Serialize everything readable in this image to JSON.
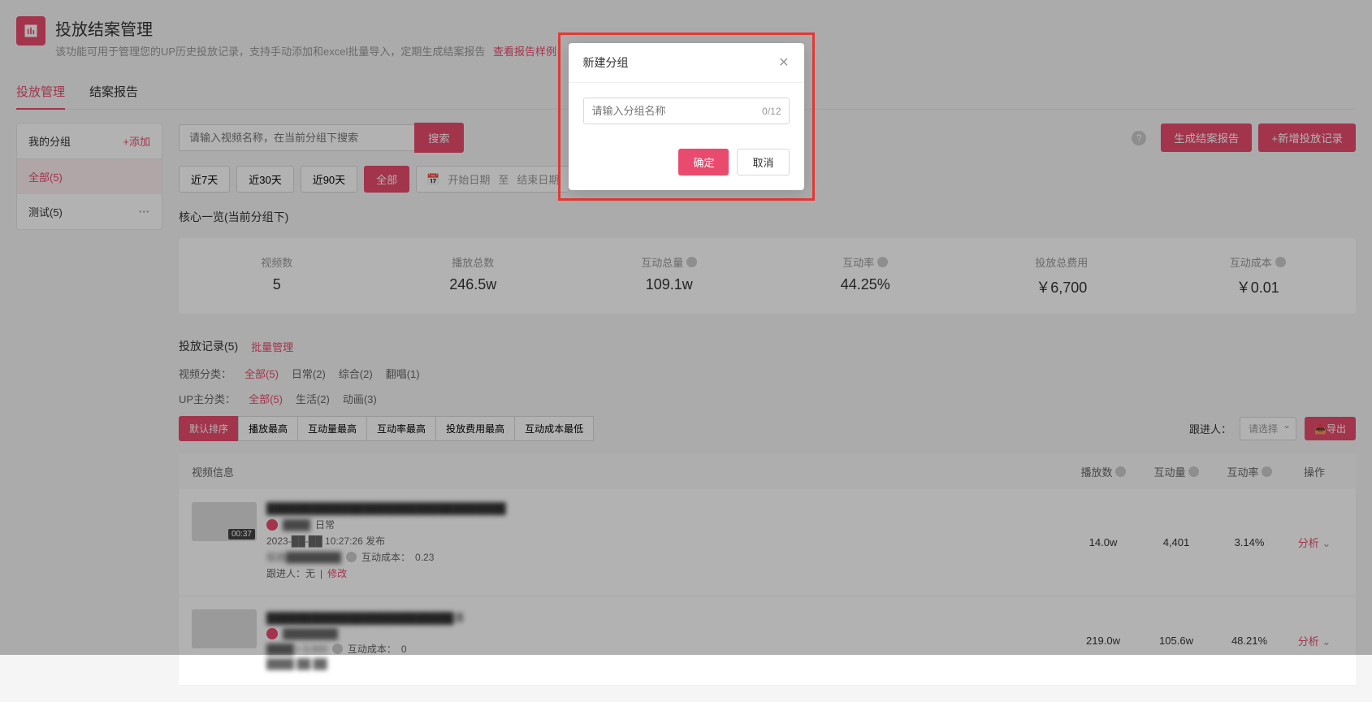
{
  "header": {
    "title": "投放结案管理",
    "subtitle": "该功能可用于管理您的UP历史投放记录，支持手动添加和excel批量导入，定期生成结案报告",
    "link": "查看报告样例"
  },
  "tabs": {
    "placement": "投放管理",
    "report": "结案报告"
  },
  "sidebar": {
    "title": "我的分组",
    "add": "+添加",
    "items": [
      {
        "label": "全部(5)"
      },
      {
        "label": "测试(5)"
      }
    ]
  },
  "search": {
    "placeholder": "请输入视频名称，在当前分组下搜索",
    "button": "搜索"
  },
  "actions": {
    "generate_report": "生成结案报告",
    "add_record": "+新增投放记录"
  },
  "date_filter": {
    "d7": "近7天",
    "d30": "近30天",
    "d90": "近90天",
    "all": "全部",
    "start": "开始日期",
    "to": "至",
    "end": "结束日期"
  },
  "overview": {
    "title": "核心一览(当前分组下)",
    "stats": [
      {
        "label": "视频数",
        "value": "5"
      },
      {
        "label": "播放总数",
        "value": "246.5w"
      },
      {
        "label": "互动总量",
        "value": "109.1w"
      },
      {
        "label": "互动率",
        "value": "44.25%"
      },
      {
        "label": "投放总费用",
        "value": "￥6,700"
      },
      {
        "label": "互动成本",
        "value": "￥0.01"
      }
    ]
  },
  "records": {
    "title": "投放记录(5)",
    "batch": "批量管理",
    "video_category_label": "视频分类：",
    "video_categories": [
      {
        "label": "全部(5)",
        "active": true
      },
      {
        "label": "日常(2)"
      },
      {
        "label": "综合(2)"
      },
      {
        "label": "翻唱(1)"
      }
    ],
    "up_category_label": "UP主分类：",
    "up_categories": [
      {
        "label": "全部(5)",
        "active": true
      },
      {
        "label": "生活(2)"
      },
      {
        "label": "动画(3)"
      }
    ]
  },
  "sort": {
    "options": [
      {
        "label": "默认排序",
        "active": true
      },
      {
        "label": "播放最高"
      },
      {
        "label": "互动量最高"
      },
      {
        "label": "互动率最高"
      },
      {
        "label": "投放费用最高"
      },
      {
        "label": "互动成本最低"
      }
    ],
    "follower_label": "跟进人：",
    "follower_placeholder": "请选择",
    "export": "导出"
  },
  "table": {
    "headers": {
      "info": "视频信息",
      "plays": "播放数",
      "interactions": "互动量",
      "rate": "互动率",
      "action": "操作"
    },
    "rows": [
      {
        "title": "████████████████████████████████",
        "duration": "00:37",
        "tag": "日常",
        "publish": "2023-██-██ 10:27:26 发布",
        "cost_label": "投放████████",
        "interact_cost_label": "互动成本：",
        "interact_cost": "0.23",
        "follower_label": "跟进人：无",
        "modify": "修改",
        "plays": "14.0w",
        "interactions": "4,401",
        "rate": "3.14%",
        "analyze": "分析"
      },
      {
        "title": "█████████████████████████清",
        "publish": "████████",
        "cost_label": "████ • 3,000",
        "interact_cost_label": "互动成本：",
        "interact_cost": "0",
        "follower_label": "████ ██ ██",
        "plays": "219.0w",
        "interactions": "105.6w",
        "rate": "48.21%",
        "analyze": "分析"
      }
    ]
  },
  "modal": {
    "title": "新建分组",
    "placeholder": "请输入分组名称",
    "count": "0/12",
    "confirm": "确定",
    "cancel": "取消"
  }
}
